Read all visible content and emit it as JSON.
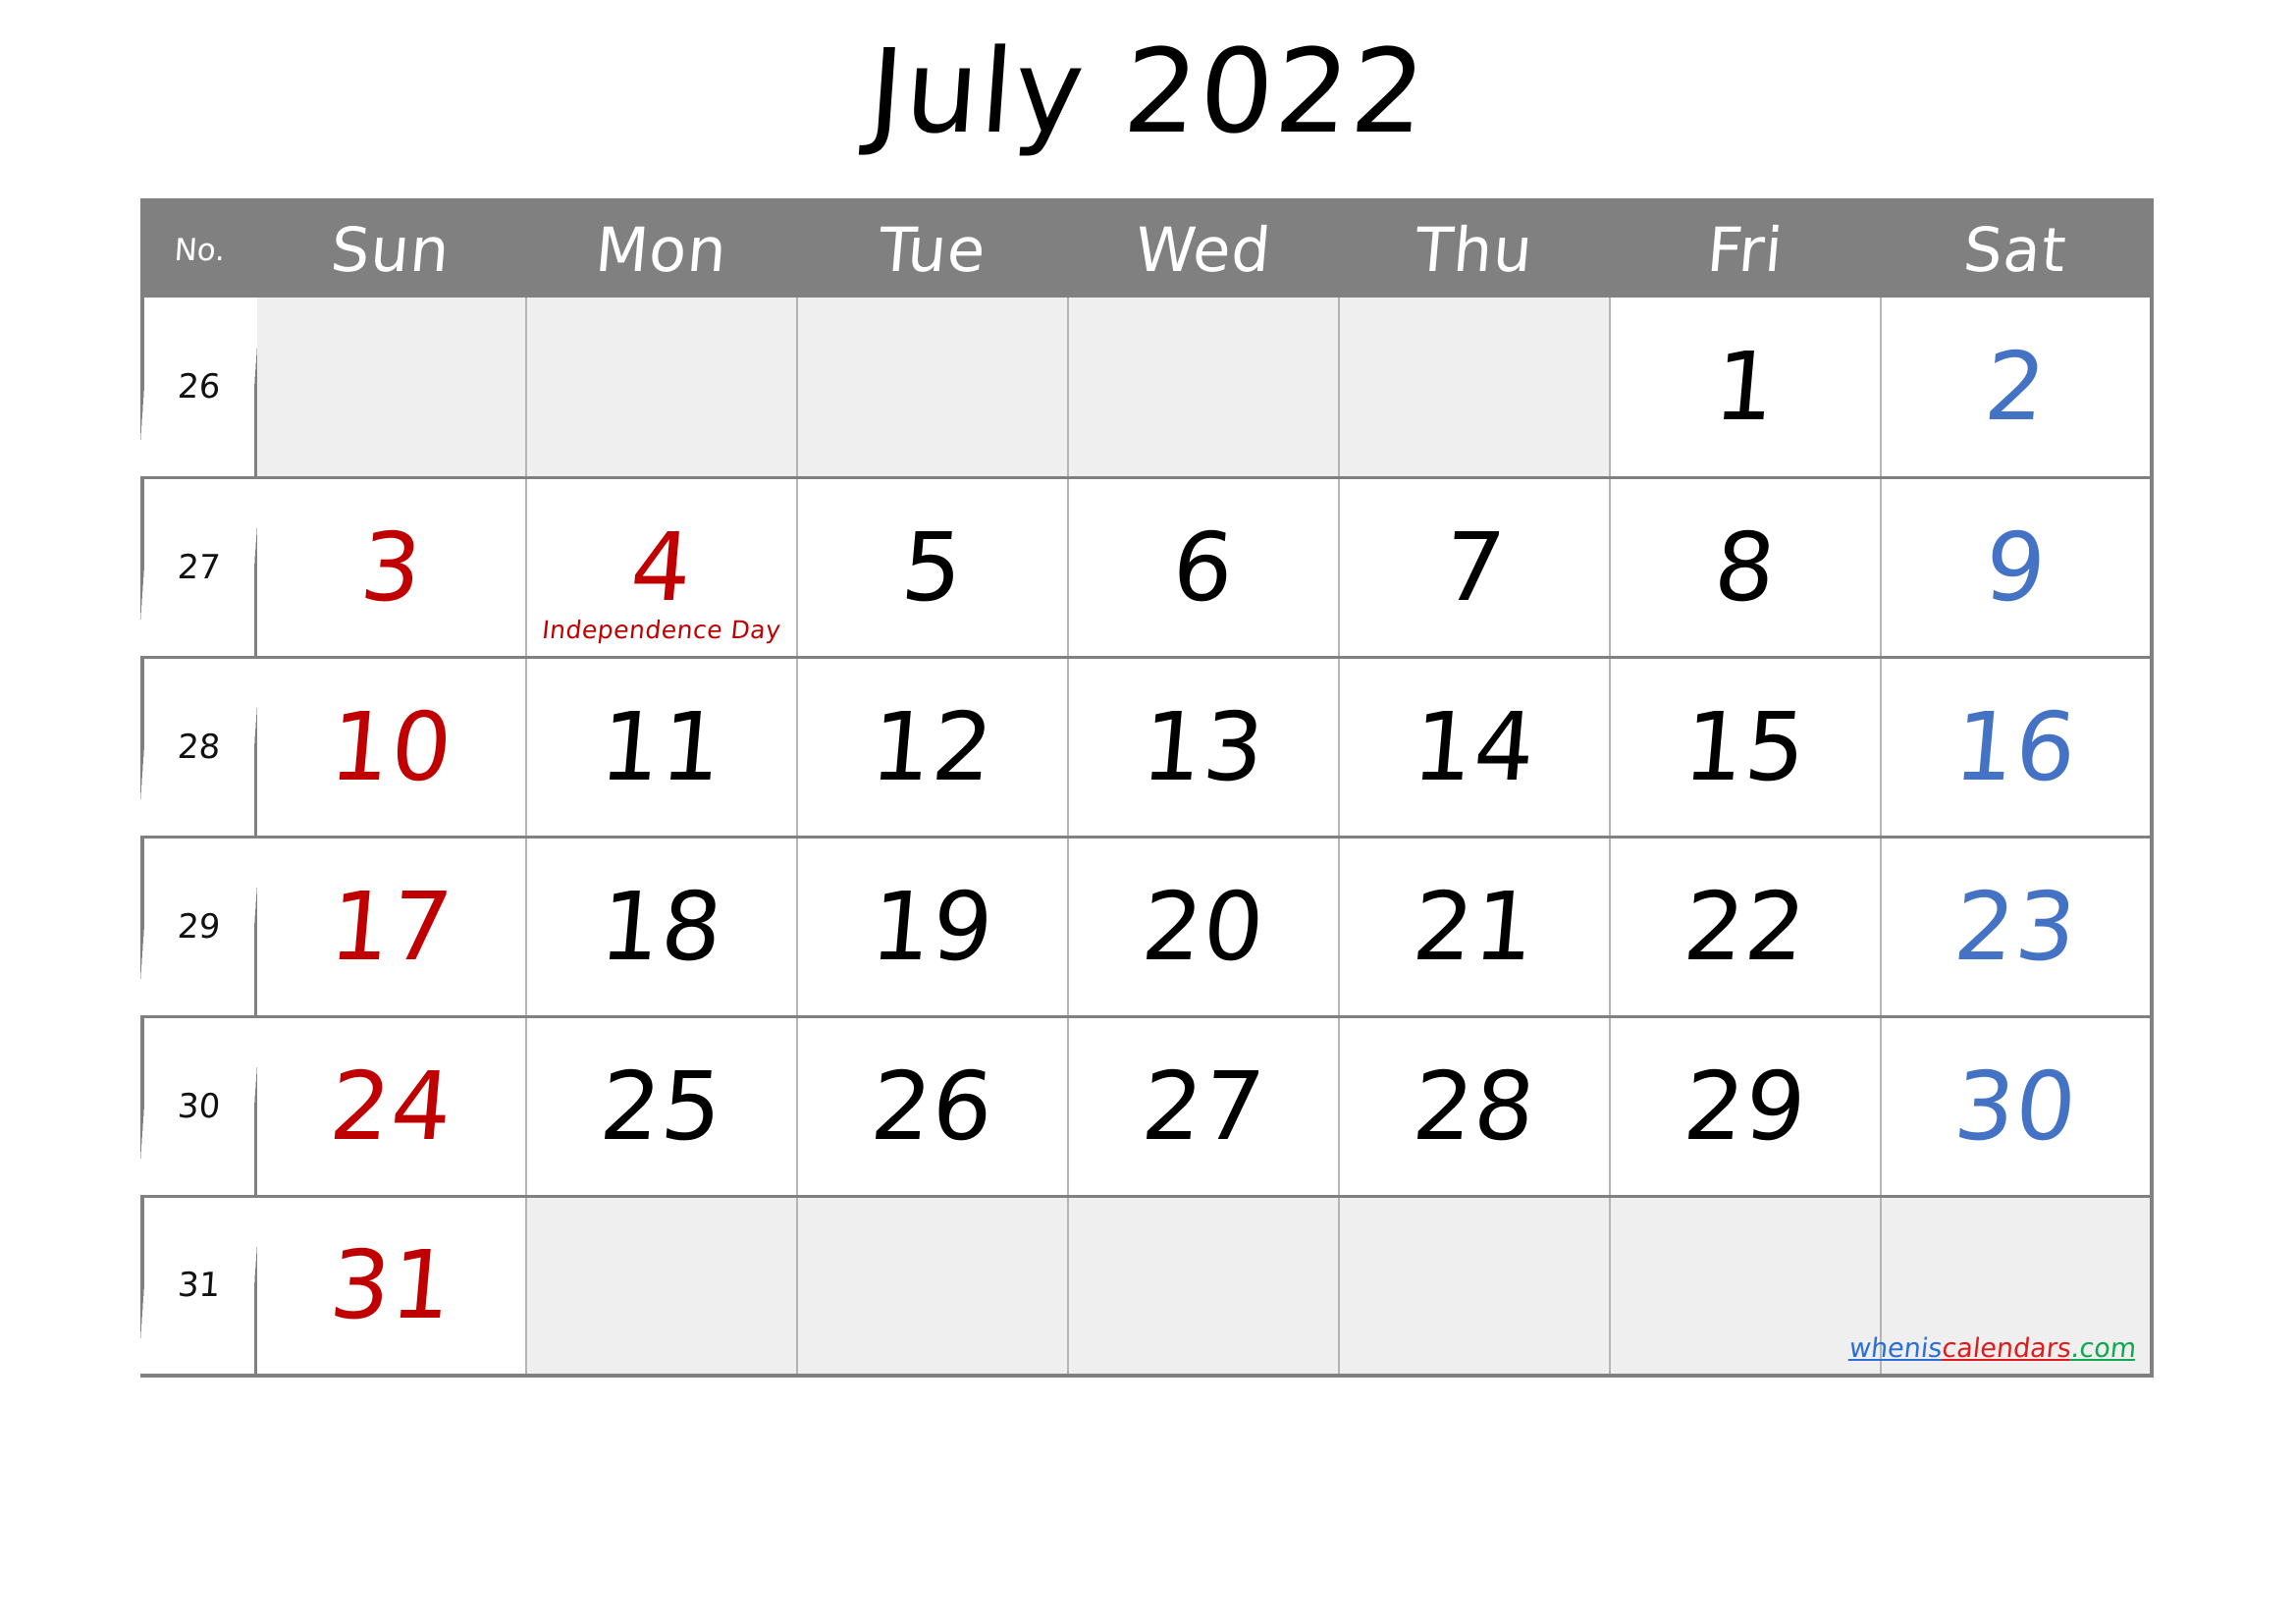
{
  "title": "July 2022",
  "header": {
    "week_number_label": "No.",
    "days": [
      "Sun",
      "Mon",
      "Tue",
      "Wed",
      "Thu",
      "Fri",
      "Sat"
    ]
  },
  "colors": {
    "header_bg": "#808080",
    "grid_border": "#808080",
    "empty_cell_bg": "#efefef",
    "sunday": "#c00000",
    "saturday": "#4472c4",
    "weekday": "#000000",
    "holiday_text": "#c00000"
  },
  "weeks": [
    {
      "no": "26",
      "days": [
        {
          "n": "",
          "kind": "empty"
        },
        {
          "n": "",
          "kind": "empty"
        },
        {
          "n": "",
          "kind": "empty"
        },
        {
          "n": "",
          "kind": "empty"
        },
        {
          "n": "",
          "kind": "empty"
        },
        {
          "n": "1",
          "kind": "wd"
        },
        {
          "n": "2",
          "kind": "sat"
        }
      ]
    },
    {
      "no": "27",
      "days": [
        {
          "n": "3",
          "kind": "sun"
        },
        {
          "n": "4",
          "kind": "sun",
          "holiday": "Independence Day"
        },
        {
          "n": "5",
          "kind": "wd"
        },
        {
          "n": "6",
          "kind": "wd"
        },
        {
          "n": "7",
          "kind": "wd"
        },
        {
          "n": "8",
          "kind": "wd"
        },
        {
          "n": "9",
          "kind": "sat"
        }
      ]
    },
    {
      "no": "28",
      "days": [
        {
          "n": "10",
          "kind": "sun"
        },
        {
          "n": "11",
          "kind": "wd"
        },
        {
          "n": "12",
          "kind": "wd"
        },
        {
          "n": "13",
          "kind": "wd"
        },
        {
          "n": "14",
          "kind": "wd"
        },
        {
          "n": "15",
          "kind": "wd"
        },
        {
          "n": "16",
          "kind": "sat"
        }
      ]
    },
    {
      "no": "29",
      "days": [
        {
          "n": "17",
          "kind": "sun"
        },
        {
          "n": "18",
          "kind": "wd"
        },
        {
          "n": "19",
          "kind": "wd"
        },
        {
          "n": "20",
          "kind": "wd"
        },
        {
          "n": "21",
          "kind": "wd"
        },
        {
          "n": "22",
          "kind": "wd"
        },
        {
          "n": "23",
          "kind": "sat"
        }
      ]
    },
    {
      "no": "30",
      "days": [
        {
          "n": "24",
          "kind": "sun"
        },
        {
          "n": "25",
          "kind": "wd"
        },
        {
          "n": "26",
          "kind": "wd"
        },
        {
          "n": "27",
          "kind": "wd"
        },
        {
          "n": "28",
          "kind": "wd"
        },
        {
          "n": "29",
          "kind": "wd"
        },
        {
          "n": "30",
          "kind": "sat"
        }
      ]
    },
    {
      "no": "31",
      "days": [
        {
          "n": "31",
          "kind": "sun"
        },
        {
          "n": "",
          "kind": "empty"
        },
        {
          "n": "",
          "kind": "empty"
        },
        {
          "n": "",
          "kind": "empty"
        },
        {
          "n": "",
          "kind": "empty"
        },
        {
          "n": "",
          "kind": "empty"
        },
        {
          "n": "",
          "kind": "empty",
          "watermark": true
        }
      ]
    }
  ],
  "watermark": {
    "part1": "whenis",
    "part2": "calendars",
    "part3": ".com"
  }
}
